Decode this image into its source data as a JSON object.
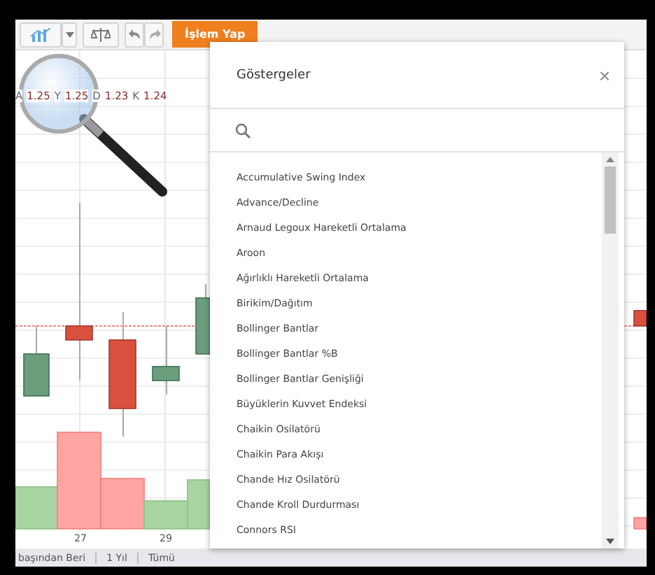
{
  "toolbar": {
    "action_button": "İşlem Yap"
  },
  "readout": [
    {
      "label": "A",
      "value": "1.25"
    },
    {
      "label": "Y",
      "value": "1.25"
    },
    {
      "label": "D",
      "value": "1.23"
    },
    {
      "label": "K",
      "value": "1.24"
    }
  ],
  "chart": {
    "x_labels": [
      "27",
      "29"
    ]
  },
  "range_buttons": [
    "başından Beri",
    "1 Yıl",
    "Tümü"
  ],
  "dialog": {
    "title": "Göstergeler",
    "close": "×",
    "items": [
      "Accumulative Swing Index",
      "Advance/Decline",
      "Arnaud Legoux Hareketli Ortalama",
      "Aroon",
      "Ağırlıklı Hareketli Ortalama",
      "Birikim/Dağıtım",
      "Bollinger Bantlar",
      "Bollinger Bantlar %B",
      "Bollinger Bantlar Genişliği",
      "Büyüklerin Kuvvet Endeksi",
      "Chaikin Osilatörü",
      "Chaikin Para Akışı",
      "Chande Hız Osilatörü",
      "Chande Kroll Durdurması",
      "Connors RSI"
    ]
  }
}
